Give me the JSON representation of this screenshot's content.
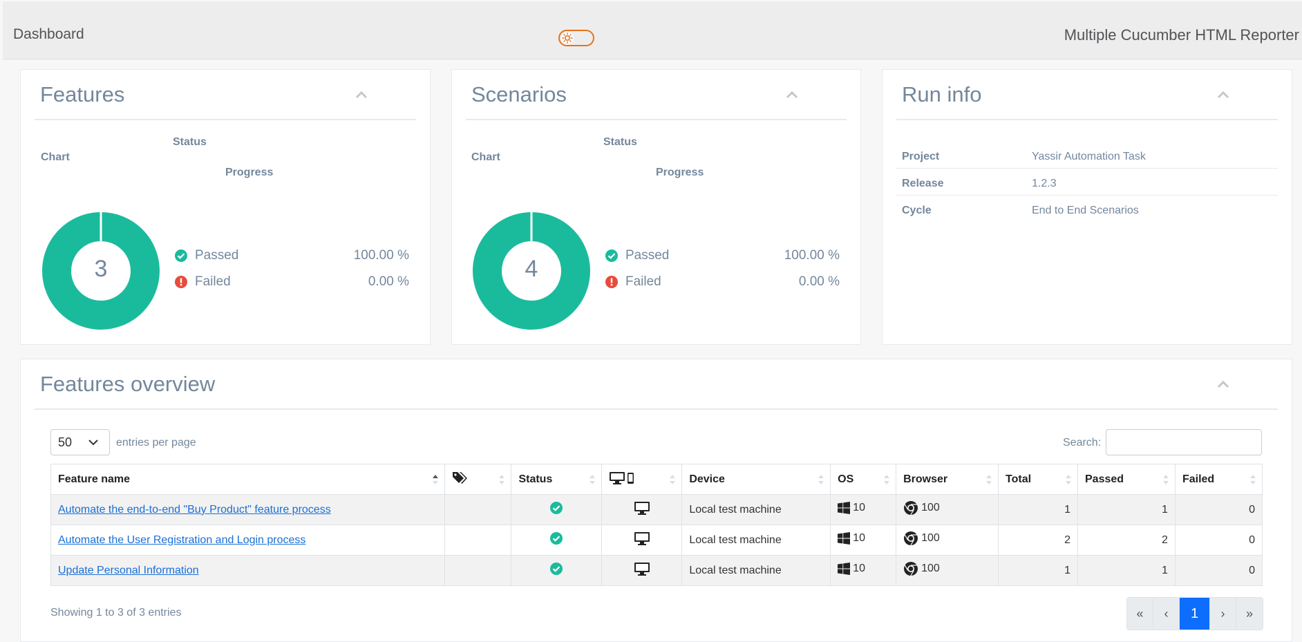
{
  "header": {
    "title": "Dashboard",
    "reporter": "Multiple Cucumber HTML Reporter"
  },
  "colors": {
    "passed": "#1abb9c",
    "failed": "#e74c3c",
    "accent": "#e8711c",
    "link": "#1a6fd6",
    "page_active": "#0d6efd"
  },
  "features_panel": {
    "title": "Features",
    "col_chart": "Chart",
    "col_status": "Status",
    "col_progress": "Progress",
    "total": "3",
    "passed_label": "Passed",
    "passed_pct": "100.00 %",
    "failed_label": "Failed",
    "failed_pct": "0.00 %"
  },
  "scenarios_panel": {
    "title": "Scenarios",
    "col_chart": "Chart",
    "col_status": "Status",
    "col_progress": "Progress",
    "total": "4",
    "passed_label": "Passed",
    "passed_pct": "100.00 %",
    "failed_label": "Failed",
    "failed_pct": "0.00 %"
  },
  "chart_data": [
    {
      "type": "pie",
      "categories": [
        "Passed",
        "Failed"
      ],
      "values": [
        100,
        0
      ],
      "center_value": 3
    },
    {
      "type": "pie",
      "categories": [
        "Passed",
        "Failed"
      ],
      "values": [
        100,
        0
      ],
      "center_value": 4
    }
  ],
  "run_info": {
    "title": "Run info",
    "rows": [
      {
        "key": "Project",
        "value": "Yassir Automation Task"
      },
      {
        "key": "Release",
        "value": "1.2.3"
      },
      {
        "key": "Cycle",
        "value": "End to End Scenarios"
      }
    ]
  },
  "overview": {
    "title": "Features overview",
    "entries_value": "50",
    "entries_label": "entries per page",
    "search_label": "Search:",
    "columns": {
      "feature": "Feature name",
      "status": "Status",
      "device": "Device",
      "os": "OS",
      "browser": "Browser",
      "total": "Total",
      "passed": "Passed",
      "failed": "Failed"
    },
    "rows": [
      {
        "name": "Automate the end-to-end \"Buy Product\" feature process",
        "device": "Local test machine",
        "os": "10",
        "browser": "100",
        "total": "1",
        "passed": "1",
        "failed": "0"
      },
      {
        "name": "Automate the User Registration and Login process",
        "device": "Local test machine",
        "os": "10",
        "browser": "100",
        "total": "2",
        "passed": "2",
        "failed": "0"
      },
      {
        "name": "Update Personal Information",
        "device": "Local test machine",
        "os": "10",
        "browser": "100",
        "total": "1",
        "passed": "1",
        "failed": "0"
      }
    ],
    "showing": "Showing 1 to 3 of 3 entries",
    "pager": {
      "first": "«",
      "prev": "‹",
      "current": "1",
      "next": "›",
      "last": "»"
    }
  }
}
